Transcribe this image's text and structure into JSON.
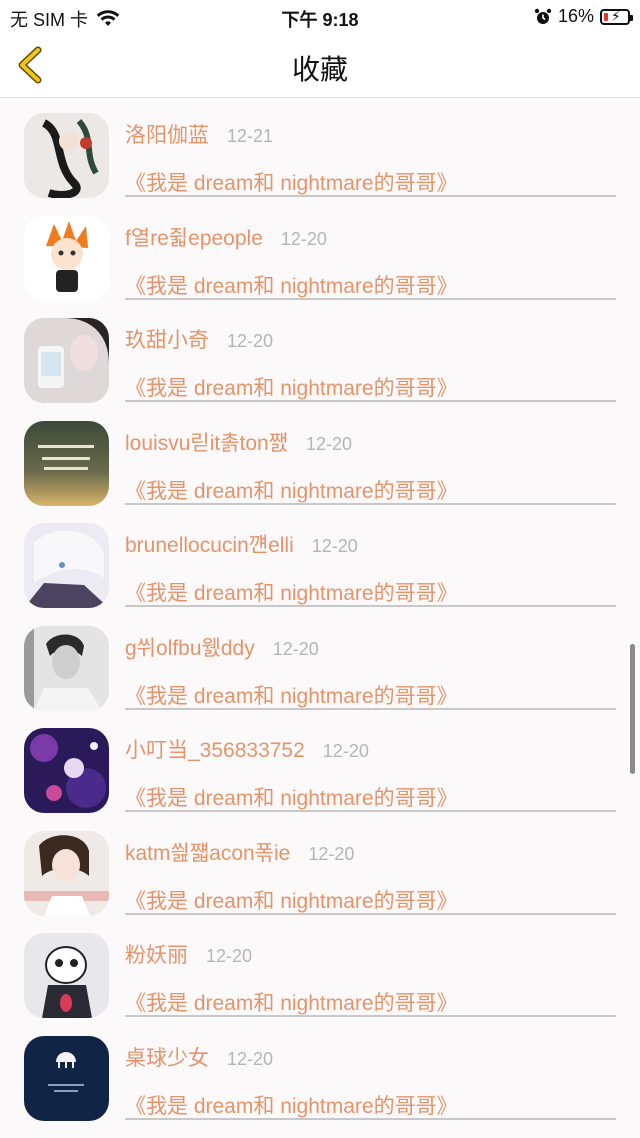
{
  "status": {
    "carrier": "无 SIM 卡",
    "time": "下午 9:18",
    "battery": "16%"
  },
  "nav": {
    "title": "收藏"
  },
  "items": [
    {
      "name": "洛阳伽蓝",
      "date": "12-21",
      "title": "《我是 dream和 nightmare的哥哥》"
    },
    {
      "name": "f열re쥛epeople",
      "date": "12-20",
      "title": "《我是 dream和 nightmare的哥哥》"
    },
    {
      "name": "玖甜小奇",
      "date": "12-20",
      "title": "《我是 dream和 nightmare的哥哥》"
    },
    {
      "name": "louisvu릳it촑ton쨄",
      "date": "12-20",
      "title": "《我是 dream和 nightmare的哥哥》"
    },
    {
      "name": "brunellocucin꺤elli",
      "date": "12-20",
      "title": "《我是 dream和 nightmare的哥哥》"
    },
    {
      "name": "g쒸olfbu웴ddy",
      "date": "12-20",
      "title": "《我是 dream和 nightmare的哥哥》"
    },
    {
      "name": "小叮当_356833752",
      "date": "12-20",
      "title": "《我是 dream和 nightmare的哥哥》"
    },
    {
      "name": "katm씚쨻acon폮ie",
      "date": "12-20",
      "title": "《我是 dream和 nightmare的哥哥》"
    },
    {
      "name": "粉妖丽",
      "date": "12-20",
      "title": "《我是 dream和 nightmare的哥哥》"
    },
    {
      "name": "桌球少女",
      "date": "12-20",
      "title": "《我是 dream和 nightmare的哥哥》"
    }
  ],
  "colors": {
    "accent": "#e5946a",
    "date": "#b5b5b5",
    "back_arrow": "#e6b400"
  },
  "icons": {
    "wifi": "wifi-icon",
    "alarm": "alarm-icon",
    "battery": "battery-icon",
    "back": "back-chevron-icon"
  }
}
